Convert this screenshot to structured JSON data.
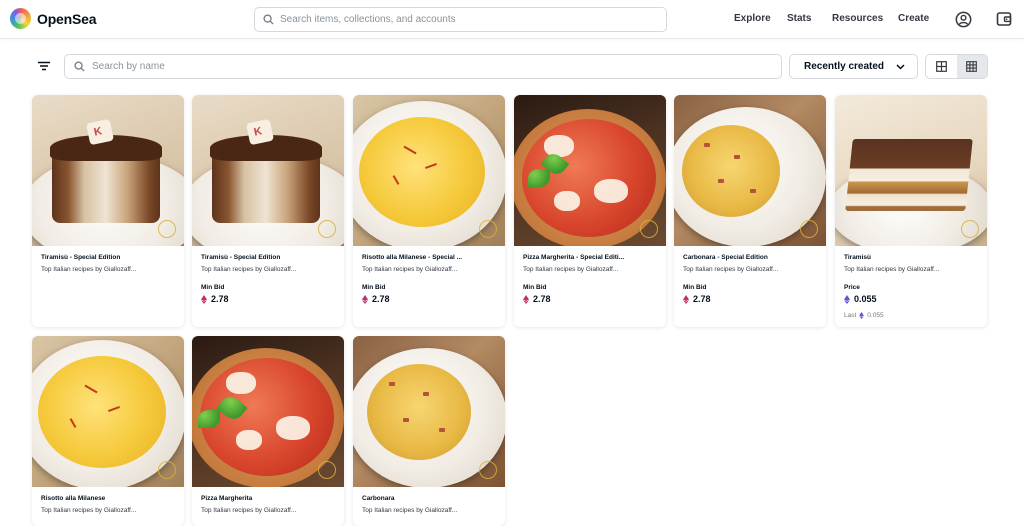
{
  "app": {
    "name": "OpenSea"
  },
  "header": {
    "search_placeholder": "Search items, collections, and accounts",
    "nav": [
      "Explore",
      "Stats",
      "Resources",
      "Create"
    ]
  },
  "toolbar": {
    "name_search_placeholder": "Search by name",
    "sort_label": "Recently created"
  },
  "items": [
    {
      "title": "Tiramisù - Special Edition",
      "collection": "Top Italian recipes by Giallozaff...",
      "price_label": "Min Bid",
      "price": "2.78",
      "currency": "weth",
      "last": ""
    },
    {
      "title": "Tiramisù - Special Edition",
      "collection": "Top Italian recipes by Giallozaff...",
      "price_label": "Min Bid",
      "price": "2.78",
      "currency": "weth",
      "last": ""
    },
    {
      "title": "Risotto alla Milanese - Special ...",
      "collection": "Top Italian recipes by Giallozaff...",
      "price_label": "Min Bid",
      "price": "2.78",
      "currency": "weth",
      "last": ""
    },
    {
      "title": "Pizza Margherita - Special Editi...",
      "collection": "Top Italian recipes by Giallozaff...",
      "price_label": "Min Bid",
      "price": "2.78",
      "currency": "weth",
      "last": ""
    },
    {
      "title": "Carbonara - Special Edition",
      "collection": "Top Italian recipes by Giallozaff...",
      "price_label": "Min Bid",
      "price": "2.78",
      "currency": "weth",
      "last": ""
    },
    {
      "title": "Tiramisù",
      "collection": "Top Italian recipes by Giallozaff...",
      "price_label": "Price",
      "price": "0.055",
      "currency": "eth",
      "last_label": "Last",
      "last": "0.055"
    },
    {
      "title": "Risotto alla Milanese",
      "collection": "Top Italian recipes by Giallozaff..."
    },
    {
      "title": "Pizza Margherita",
      "collection": "Top Italian recipes by Giallozaff..."
    },
    {
      "title": "Carbonara",
      "collection": "Top Italian recipes by Giallozaff..."
    }
  ],
  "colors": {
    "weth": "#c0306a",
    "eth": "#6b4fd6",
    "active_view": "#e5e8eb"
  }
}
